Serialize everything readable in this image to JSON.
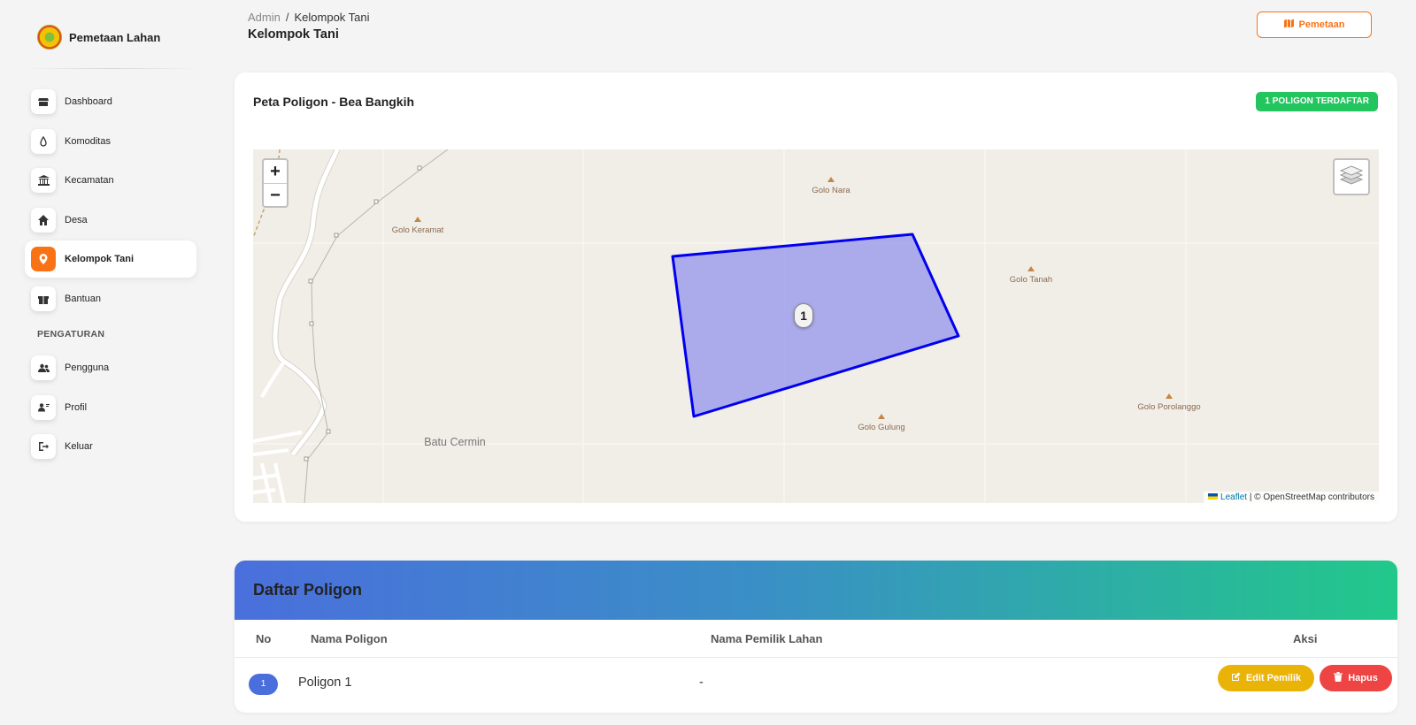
{
  "brand": {
    "name": "Pemetaan Lahan"
  },
  "sidebar": {
    "items": [
      {
        "label": "Dashboard",
        "icon": "store-icon"
      },
      {
        "label": "Komoditas",
        "icon": "drop-icon"
      },
      {
        "label": "Kecamatan",
        "icon": "institution-icon"
      },
      {
        "label": "Desa",
        "icon": "home-icon"
      },
      {
        "label": "Kelompok Tani",
        "icon": "map-pin-icon",
        "active": true
      },
      {
        "label": "Bantuan",
        "icon": "gift-icon"
      }
    ],
    "section_label": "PENGATURAN",
    "settings_items": [
      {
        "label": "Pengguna",
        "icon": "users-icon"
      },
      {
        "label": "Profil",
        "icon": "user-card-icon"
      },
      {
        "label": "Keluar",
        "icon": "logout-icon"
      }
    ]
  },
  "header": {
    "breadcrumb": {
      "root": "Admin",
      "separator": "/",
      "current": "Kelompok Tani"
    },
    "title": "Kelompok Tani",
    "pemetaan_button": "Pemetaan"
  },
  "map_card": {
    "title": "Peta Poligon - Bea Bangkih",
    "badge": "1 POLIGON TERDAFTAR",
    "zoom_in": "+",
    "zoom_out": "−",
    "polygon_label": "1",
    "places": [
      {
        "name": "Golo Nara"
      },
      {
        "name": "Golo Keramat"
      },
      {
        "name": "Golo Tanah"
      },
      {
        "name": "Golo Porolanggo"
      },
      {
        "name": "Golo Gulung"
      },
      {
        "name": "Batu Cermin"
      }
    ],
    "attribution": {
      "leaflet": "Leaflet",
      "separator": " | ",
      "osm": "© OpenStreetMap contributors"
    }
  },
  "table": {
    "heading": "Daftar Poligon",
    "columns": {
      "no": "No",
      "nama": "Nama Poligon",
      "pemilik": "Nama Pemilik Lahan",
      "aksi": "Aksi"
    },
    "rows": [
      {
        "no": "1",
        "nama": "Poligon 1",
        "pemilik": "-",
        "edit": "Edit Pemilik",
        "hapus": "Hapus"
      }
    ]
  },
  "colors": {
    "accent": "#f97316",
    "success": "#22c55e",
    "polygon_stroke": "#0000ee",
    "edit": "#eab308",
    "delete": "#ef4444"
  }
}
